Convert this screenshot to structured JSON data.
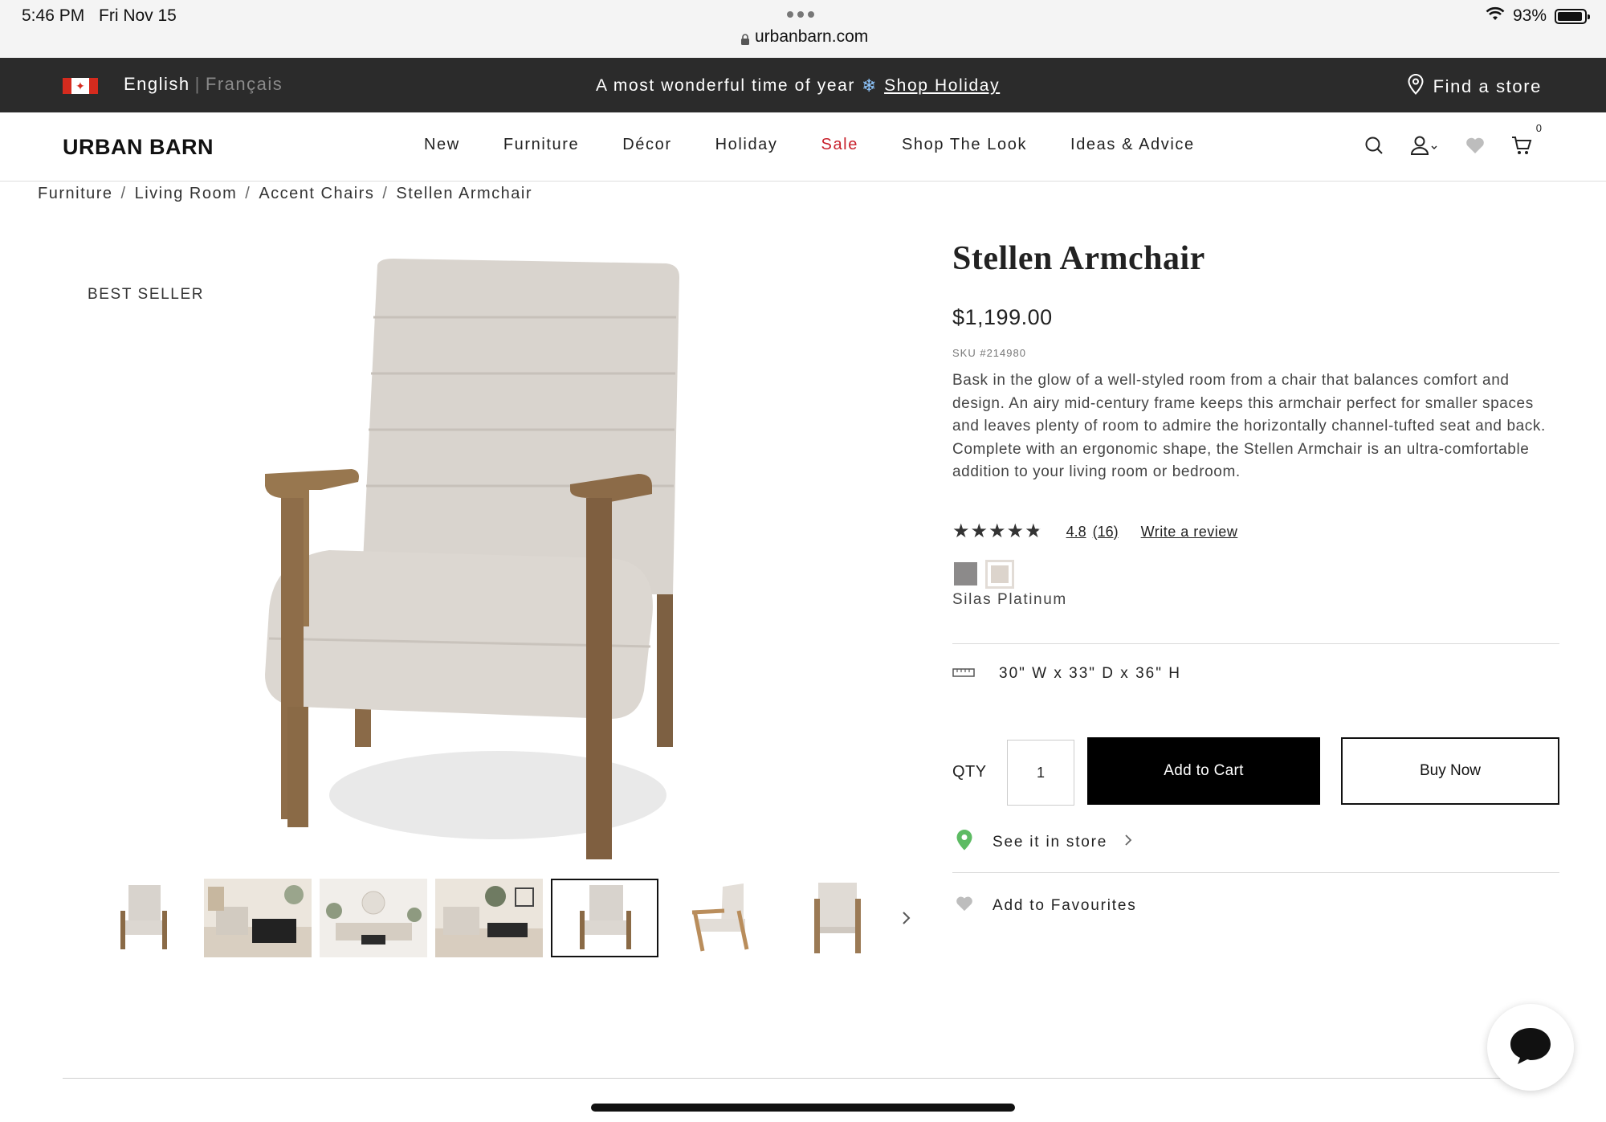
{
  "status_bar": {
    "time": "5:46 PM",
    "date": "Fri Nov 15",
    "url": "urbanbarn.com",
    "battery": "93%",
    "battery_level": 0.93
  },
  "promo_bar": {
    "lang_en": "English",
    "lang_sep": "|",
    "lang_fr": "Français",
    "message": "A most wonderful time of year",
    "link": "Shop Holiday",
    "find_store": "Find a store"
  },
  "nav": {
    "logo": "URBAN BARN",
    "items": [
      {
        "label": "New"
      },
      {
        "label": "Furniture"
      },
      {
        "label": "Décor"
      },
      {
        "label": "Holiday"
      },
      {
        "label": "Sale"
      },
      {
        "label": "Shop The Look"
      },
      {
        "label": "Ideas & Advice"
      }
    ],
    "cart_count": "0"
  },
  "breadcrumb": [
    "Furniture",
    "Living Room",
    "Accent Chairs",
    "Stellen Armchair"
  ],
  "breadcrumb_sep": "/",
  "product": {
    "badge": "BEST SELLER",
    "title": "Stellen Armchair",
    "price": "$1,199.00",
    "sku": "SKU #214980",
    "description": "Bask in the glow of a well-styled room from a chair that balances comfort and design. An airy mid-century frame keeps this armchair perfect for smaller spaces and leaves plenty of room to admire the horizontally channel-tufted seat and back. Complete with an ergonomic shape, the Stellen Armchair is an ultra-comfortable addition to your living room or bedroom.",
    "rating": "4.8",
    "rating_value": 4.8,
    "review_count": "(16)",
    "write_review": "Write a review",
    "swatch_colors": [
      "#8c8a8a",
      "#dcd4cc"
    ],
    "color_name": "Silas Platinum",
    "dimensions": "30\" W x 33\" D x 36\" H",
    "qty_label": "QTY",
    "qty_value": "1",
    "add_to_cart": "Add to Cart",
    "buy_now": "Buy Now",
    "see_in_store": "See it in store",
    "add_to_favourites": "Add to Favourites"
  },
  "colors": {
    "promo_bg": "#2b2b2b",
    "sale": "#c8202b",
    "store_pin": "#5dbb63"
  }
}
